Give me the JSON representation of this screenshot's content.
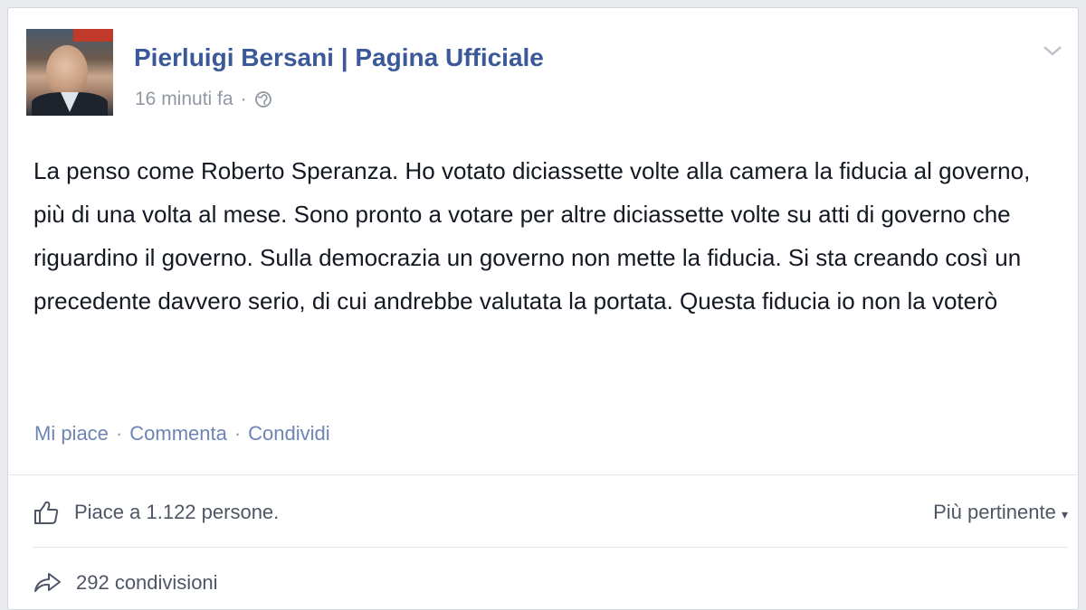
{
  "post": {
    "page_name": "Pierluigi Bersani | Pagina Ufficiale",
    "timestamp": "16 minuti fa",
    "separator": "·",
    "privacy_icon": "globe-icon",
    "text": "La penso come Roberto Speranza. Ho votato diciassette volte alla camera la fiducia al governo, più di una volta al mese. Sono pronto a votare per altre diciassette volte su atti di governo che riguardino il governo. Sulla democrazia un governo non mette la fiducia. Si sta creando così un precedente davvero serio, di cui andrebbe valutata la portata. Questa fiducia io non la voterò"
  },
  "actions": {
    "like_label": "Mi piace",
    "comment_label": "Commenta",
    "share_label": "Condividi",
    "separator": "·"
  },
  "stats": {
    "likes_text": "Piace a 1.122 persone.",
    "sort_label": "Più pertinente",
    "sort_arrow": "▾",
    "shares_text": "292 condivisioni"
  },
  "colors": {
    "brand": "#3b5998",
    "link_muted": "#6d84b4",
    "meta_grey": "#9197a3"
  }
}
